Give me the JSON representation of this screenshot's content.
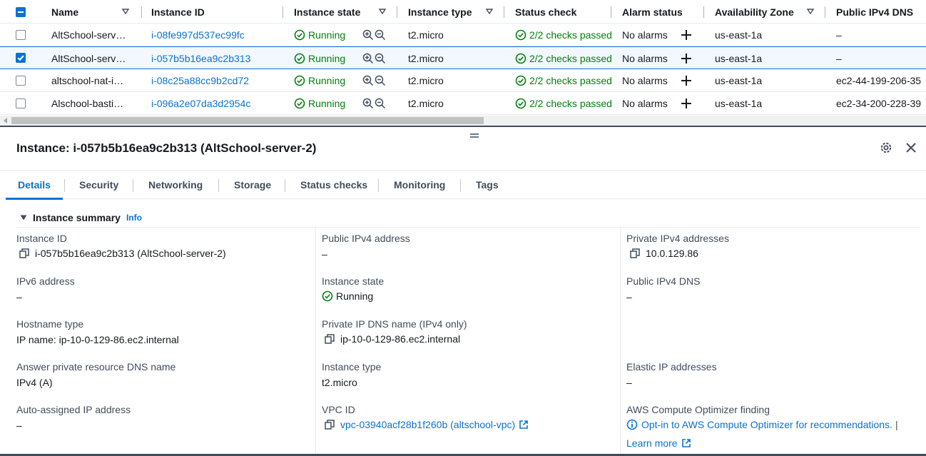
{
  "table": {
    "columns": [
      {
        "label": "Name"
      },
      {
        "label": "Instance ID"
      },
      {
        "label": "Instance state"
      },
      {
        "label": "Instance type"
      },
      {
        "label": "Status check"
      },
      {
        "label": "Alarm status"
      },
      {
        "label": "Availability Zone"
      },
      {
        "label": "Public IPv4 DNS"
      }
    ],
    "rows": [
      {
        "name": "AltSchool-serv…",
        "instance_id": "i-08fe997d537ec99fc",
        "state": "Running",
        "type": "t2.micro",
        "status_check": "2/2 checks passed",
        "alarm": "No alarms",
        "az": "us-east-1a",
        "dns": "–",
        "selected": false
      },
      {
        "name": "AltSchool-serv…",
        "instance_id": "i-057b5b16ea9c2b313",
        "state": "Running",
        "type": "t2.micro",
        "status_check": "2/2 checks passed",
        "alarm": "No alarms",
        "az": "us-east-1a",
        "dns": "–",
        "selected": true
      },
      {
        "name": "altschool-nat-i…",
        "instance_id": "i-08c25a88cc9b2cd72",
        "state": "Running",
        "type": "t2.micro",
        "status_check": "2/2 checks passed",
        "alarm": "No alarms",
        "az": "us-east-1a",
        "dns": "ec2-44-199-206-35",
        "selected": false
      },
      {
        "name": "Alschool-basti…",
        "instance_id": "i-096a2e07da3d2954c",
        "state": "Running",
        "type": "t2.micro",
        "status_check": "2/2 checks passed",
        "alarm": "No alarms",
        "az": "us-east-1a",
        "dns": "ec2-34-200-228-39",
        "selected": false
      }
    ]
  },
  "panel": {
    "title": "Instance: i-057b5b16ea9c2b313 (AltSchool-server-2)",
    "tabs": [
      {
        "label": "Details",
        "active": true
      },
      {
        "label": "Security"
      },
      {
        "label": "Networking"
      },
      {
        "label": "Storage"
      },
      {
        "label": "Status checks"
      },
      {
        "label": "Monitoring"
      },
      {
        "label": "Tags"
      }
    ],
    "summary_title": "Instance summary",
    "info_label": "Info",
    "col1": {
      "instance_id_label": "Instance ID",
      "instance_id_value": "i-057b5b16ea9c2b313 (AltSchool-server-2)",
      "ipv6_label": "IPv6 address",
      "ipv6_value": "–",
      "hostname_type_label": "Hostname type",
      "hostname_type_value": "IP name: ip-10-0-129-86.ec2.internal",
      "answer_dns_label": "Answer private resource DNS name",
      "answer_dns_value": "IPv4 (A)",
      "auto_ip_label": "Auto-assigned IP address",
      "auto_ip_value": "–"
    },
    "col2": {
      "public_ipv4_label": "Public IPv4 address",
      "public_ipv4_value": "–",
      "state_label": "Instance state",
      "state_value": "Running",
      "private_dns_label": "Private IP DNS name (IPv4 only)",
      "private_dns_value": "ip-10-0-129-86.ec2.internal",
      "type_label": "Instance type",
      "type_value": "t2.micro",
      "vpc_label": "VPC ID",
      "vpc_value": "vpc-03940acf28b1f260b (altschool-vpc)"
    },
    "col3": {
      "private_ipv4_label": "Private IPv4 addresses",
      "private_ipv4_value": "10.0.129.86",
      "public_dns_label": "Public IPv4 DNS",
      "public_dns_value": "–",
      "elastic_label": "Elastic IP addresses",
      "elastic_value": "–",
      "optimizer_label": "AWS Compute Optimizer finding",
      "optimizer_link": "Opt-in to AWS Compute Optimizer for recommendations.",
      "optimizer_sep": "|",
      "learn_more": "Learn more"
    }
  },
  "colors": {
    "link": "#0972d3",
    "success": "#037f0c",
    "divider": "#414d5c"
  }
}
